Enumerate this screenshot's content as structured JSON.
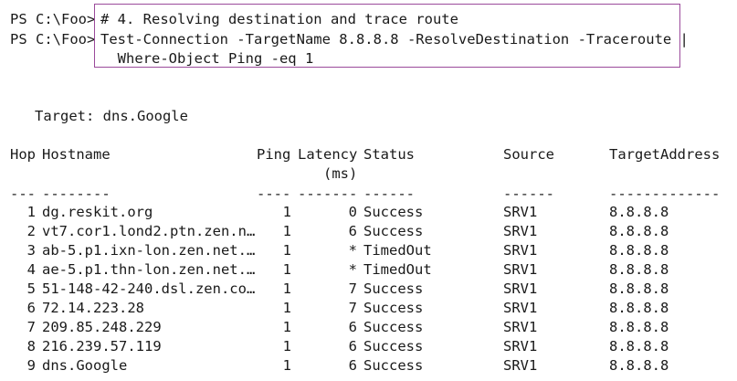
{
  "prompt": "PS C:\\Foo>",
  "commands": [
    "# 4. Resolving destination and trace route",
    "Test-Connection -TargetName 8.8.8.8 -ResolveDestination -Traceroute |",
    "  Where-Object Ping -eq 1"
  ],
  "target_line": "Target: dns.Google",
  "table": {
    "headers": {
      "hop": "Hop",
      "hostname": "Hostname",
      "ping": "Ping",
      "latency_1": "Latency",
      "latency_2": "(ms)",
      "status": "Status",
      "source": "Source",
      "target_address": "TargetAddress"
    },
    "separators": {
      "hop": "---",
      "hostname": "--------",
      "ping": "----",
      "latency": "-------",
      "status": "------",
      "source": "------",
      "target_address": "-------------"
    },
    "rows": [
      {
        "hop": "1",
        "hostname": "dg.reskit.org",
        "ping": "1",
        "latency": "0",
        "status": "Success",
        "source": "SRV1",
        "target_address": "8.8.8.8"
      },
      {
        "hop": "2",
        "hostname": "vt7.cor1.lond2.ptn.zen.n…",
        "ping": "1",
        "latency": "6",
        "status": "Success",
        "source": "SRV1",
        "target_address": "8.8.8.8"
      },
      {
        "hop": "3",
        "hostname": "ab-5.p1.ixn-lon.zen.net.…",
        "ping": "1",
        "latency": "*",
        "status": "TimedOut",
        "source": "SRV1",
        "target_address": "8.8.8.8"
      },
      {
        "hop": "4",
        "hostname": "ae-5.p1.thn-lon.zen.net.…",
        "ping": "1",
        "latency": "*",
        "status": "TimedOut",
        "source": "SRV1",
        "target_address": "8.8.8.8"
      },
      {
        "hop": "5",
        "hostname": "51-148-42-240.dsl.zen.co…",
        "ping": "1",
        "latency": "7",
        "status": "Success",
        "source": "SRV1",
        "target_address": "8.8.8.8"
      },
      {
        "hop": "6",
        "hostname": "72.14.223.28",
        "ping": "1",
        "latency": "7",
        "status": "Success",
        "source": "SRV1",
        "target_address": "8.8.8.8"
      },
      {
        "hop": "7",
        "hostname": "209.85.248.229",
        "ping": "1",
        "latency": "6",
        "status": "Success",
        "source": "SRV1",
        "target_address": "8.8.8.8"
      },
      {
        "hop": "8",
        "hostname": "216.239.57.119",
        "ping": "1",
        "latency": "6",
        "status": "Success",
        "source": "SRV1",
        "target_address": "8.8.8.8"
      },
      {
        "hop": "9",
        "hostname": "dns.Google",
        "ping": "1",
        "latency": "6",
        "status": "Success",
        "source": "SRV1",
        "target_address": "8.8.8.8"
      }
    ]
  },
  "colors": {
    "highlight_border": "#9b4a9b",
    "text": "#1a1a1a",
    "background": "#ffffff"
  }
}
